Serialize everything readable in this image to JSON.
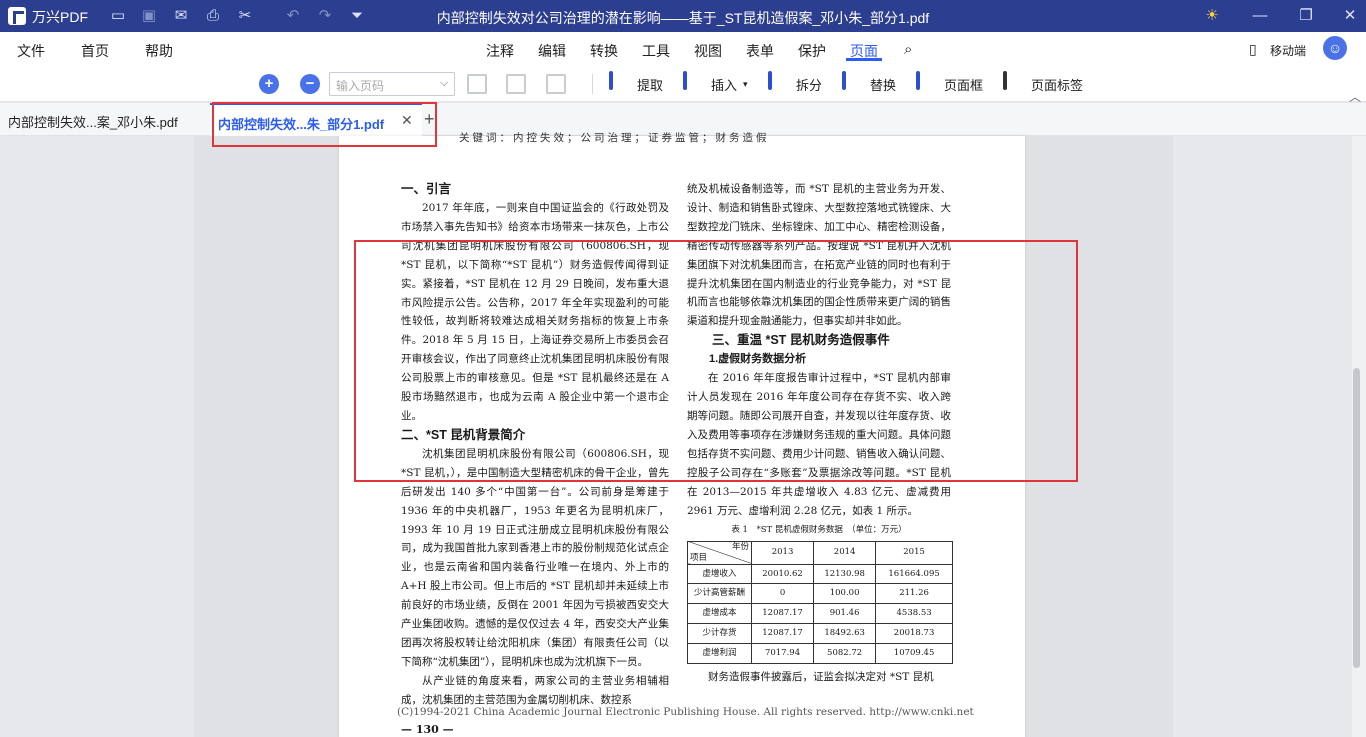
{
  "app": {
    "name": "万兴PDF"
  },
  "window": {
    "title": "内部控制失效对公司治理的潜在影响——基于_ST昆机造假案_邓小朱_部分1.pdf"
  },
  "menus": {
    "left": [
      "文件",
      "首页",
      "帮助"
    ],
    "main": [
      "注释",
      "编辑",
      "转换",
      "工具",
      "视图",
      "表单",
      "保护",
      "页面"
    ],
    "active": "页面",
    "mobile": "移动端"
  },
  "toolbar": {
    "page_input_placeholder": "输入页码",
    "extract": "提取",
    "insert": "插入",
    "split": "拆分",
    "replace": "替换",
    "page_frame": "页面框",
    "page_label": "页面标签"
  },
  "tabs": [
    {
      "label": "内部控制失效...案_邓小朱.pdf"
    },
    {
      "label": "内部控制失效...朱_部分1.pdf"
    }
  ],
  "document": {
    "top_fragment": "关键词：内控失效；公司治理；证券监管；财务造假",
    "left": {
      "h_intro": "一、引言",
      "p_intro": "2017 年年底，一则来自中国证监会的《行政处罚及市场禁入事先告知书》给资本市场带来一抹灰色，上市公司沈机集团昆明机床股份有限公司（600806.SH，现 *ST 昆机，以下简称“*ST 昆机”）财务造假传闻得到证实。紧接着，*ST 昆机在 12 月 29 日晚间，发布重大退市风险提示公告。公告称，2017 年全年实现盈利的可能性较低，故判断将较难达成相关财务指标的恢复上市条件。2018 年 5 月 15 日，上海证券交易所上市委员会召开审核会议，作出了同意终止沈机集团昆明机床股份有限公司股票上市的审核意见。但是 *ST 昆机最终还是在 A 股市场黯然退市，也成为云南 A 股企业中第一个退市企业。",
      "h_bg": "二、*ST 昆机背景简介",
      "p_bg": "沈机集团昆明机床股份有限公司（600806.SH，现 *ST 昆机，），是中国制造大型精密机床的骨干企业，曾先后研发出 140 多个“中国第一台”。公司前身是筹建于 1936 年的中央机器厂，1953 年更名为昆明机床厂，1993 年 10 月 19 日正式注册成立昆明机床股份有限公司，成为我国首批九家到香港上市的股份制规范化试点企业，也是云南省和国内装备行业唯一在境内、外上市的 A+H 股上市公司。但上市后的 *ST 昆机却并未延续上市前良好的市场业绩，反倒在 2001 年因为亏损被西安交大产业集团收购。遗憾的是仅仅过去 4 年，西安交大产业集团再次将股权转让给沈阳机床（集团）有限责任公司（以下简称“沈机集团”），昆明机床也成为沈机旗下一员。",
      "p_chain": "从产业链的角度来看，两家公司的主营业务相辅相成，沈机集团的主营范围为金属切削机床、数控系"
    },
    "right": {
      "p_cont": "统及机械设备制造等，而 *ST 昆机的主营业务为开发、设计、制造和销售卧式镗床、大型数控落地式铣镗床、大型数控龙门铣床、坐标镗床、加工中心、精密检测设备，精密传动传感器等系列产品。按理说 *ST 昆机并入沈机集团旗下对沈机集团而言，在拓宽产业链的同时也有利于提升沈机集团在国内制造业的行业竞争能力，对 *ST 昆机而言也能够依靠沈机集团的国企性质带来更广阔的销售渠道和提升现金融通能力，但事实却并非如此。",
      "h_revisit": "三、重温 *ST 昆机财务造假事件",
      "h_false": "1.虚假财务数据分析",
      "p_false": "在 2016 年年度报告审计过程中，*ST 昆机内部审计人员发现在 2016 年年度公司存在存货不实、收入跨期等问题。随即公司展开自查，并发现以往年度存货、收入及费用等事项存在涉嫌财务违规的重大问题。具体问题包括存货不实问题、费用少计问题、销售收入确认问题、控股子公司存在“多账套”及票据涂改等问题。*ST 昆机在 2013—2015 年共虚增收入 4.83 亿元、虚减费用 2961 万元、虚增利润 2.28 亿元，如表 1 所示。",
      "table_caption": "表 1　*ST 昆机虚假财务数据　（单位：万元）",
      "table": {
        "corner_top": "年份",
        "corner_bottom": "项目",
        "years": [
          "2013",
          "2014",
          "2015"
        ],
        "rows": [
          {
            "label": "虚增收入",
            "values": [
              "20010.62",
              "12130.98",
              "161664.095"
            ]
          },
          {
            "label": "少计高管薪酬",
            "values": [
              "0",
              "100.00",
              "211.26"
            ]
          },
          {
            "label": "虚增成本",
            "values": [
              "12087.17",
              "901.46",
              "4538.53"
            ]
          },
          {
            "label": "少计存货",
            "values": [
              "12087.17",
              "18492.63",
              "20018.73"
            ]
          },
          {
            "label": "虚增利润",
            "values": [
              "7017.94",
              "5082.72",
              "10709.45"
            ]
          }
        ]
      },
      "p_after": "财务造假事件披露后，证监会拟决定对 *ST 昆机"
    },
    "footer_copyright": "(C)1994-2021 China Academic Journal Electronic Publishing House. All rights reserved.    http://www.cnki.net",
    "page_number": "— 130 —"
  }
}
